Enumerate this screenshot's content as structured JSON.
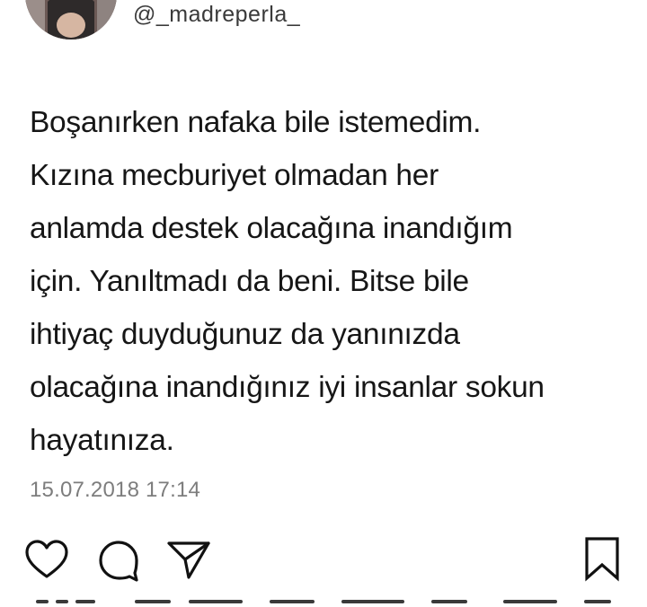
{
  "post": {
    "username": "@_madreperla_",
    "text_lines": [
      "Boşanırken nafaka bile istemedim.",
      "Kızına mecburiyet olmadan her",
      "anlamda destek olacağına inandığım",
      "için. Yanıltmadı da beni. Bitse bile",
      "ihtiyaç duyduğunuz da yanınızda",
      "olacağına inandığınız iyi insanlar sokun",
      "hayatınıza."
    ],
    "timestamp": "15.07.2018 17:14"
  },
  "actions": {
    "like_icon": "heart-outline",
    "comment_icon": "speech-bubble-outline",
    "share_icon": "paper-plane-outline",
    "save_icon": "bookmark-outline"
  }
}
